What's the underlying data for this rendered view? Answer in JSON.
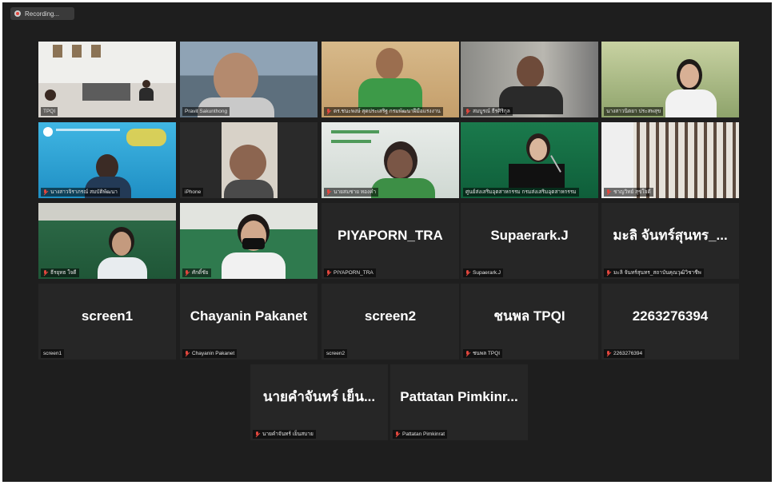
{
  "recording": {
    "label": "Recording..."
  },
  "tiles": [
    {
      "caption": "TPQI"
    },
    {
      "caption": "Pravit Sakunthong"
    },
    {
      "caption": "ดร.ชนะพงษ์ สุดประเสริฐ กรมพัฒนาฝีมือแรงงาน"
    },
    {
      "caption": "สมบูรณ์ ธีรศิริกุล"
    },
    {
      "caption": "นางสาวนิตยา ประสพสุข"
    },
    {
      "caption": "นางสาวจิราภรณ์ สมบัติพัฒนา"
    },
    {
      "caption": "iPhone"
    },
    {
      "caption": "นายสมชาย ทองคำ"
    },
    {
      "caption": "ศูนย์ส่งเสริมอุตสาหกรรม กรมส่งเสริมอุตสาหกรรม"
    },
    {
      "caption": "ชาญวิทย์ สุขใจดี"
    },
    {
      "caption": "ธีรยุทธ ใจดี"
    },
    {
      "caption": "ศักดิ์ชัย"
    },
    {
      "name": "PIYAPORN_TRA",
      "caption": "PIYAPORN_TRA"
    },
    {
      "name": "Supaerark.J",
      "caption": "Supaerark.J"
    },
    {
      "name": "มะลิ จันทร์สุนทร_...",
      "caption": "มะลิ จันทร์สุนทร_สถาบันคุณวุฒิวิชาชีพ"
    },
    {
      "name": "screen1",
      "caption": "screen1"
    },
    {
      "name": "Chayanin Pakanet",
      "caption": "Chayanin Pakanet"
    },
    {
      "name": "screen2",
      "caption": "screen2"
    },
    {
      "name": "ชนพล TPQI",
      "caption": "ชนพล TPQI"
    },
    {
      "name": "2263276394",
      "caption": "2263276394"
    },
    {
      "name": "นายคำจันทร์ เย็น...",
      "caption": "นายคำจันทร์ เย็นสบาย"
    },
    {
      "name": "Pattatan Pimkinr...",
      "caption": "Pattatan Pimkinrat"
    }
  ]
}
